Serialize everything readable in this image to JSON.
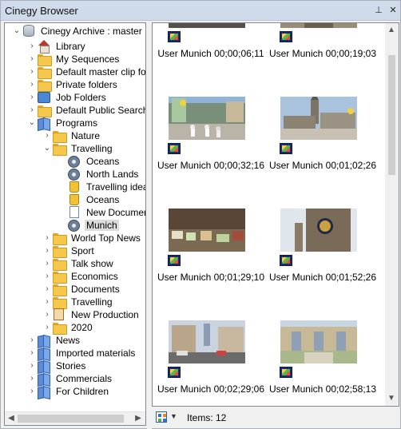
{
  "window": {
    "title": "Cinegy Browser",
    "pin_glyph": "⊥",
    "close_glyph": "✕"
  },
  "tree": {
    "items": [
      {
        "label": "Cinegy Archive : master",
        "icon": "database-icon",
        "expander": "collapse"
      },
      {
        "label": "Library",
        "icon": "library-icon",
        "expander": "expand"
      },
      {
        "label": "My Sequences",
        "icon": "folder-icon",
        "expander": "expand"
      },
      {
        "label": "Default master clip folder",
        "icon": "folder-icon",
        "expander": "expand"
      },
      {
        "label": "Private folders",
        "icon": "folder-icon",
        "expander": "expand"
      },
      {
        "label": "Job Folders",
        "icon": "job-folder-icon",
        "expander": "expand"
      },
      {
        "label": "Default Public Search Fo",
        "icon": "folder-icon",
        "expander": "expand"
      },
      {
        "label": "Programs",
        "icon": "book-icon",
        "expander": "collapse"
      },
      {
        "label": "Nature",
        "icon": "folder-icon",
        "expander": "expand"
      },
      {
        "label": "Travelling",
        "icon": "folder-icon",
        "expander": "collapse"
      },
      {
        "label": "Oceans",
        "icon": "reel-icon",
        "expander": "none"
      },
      {
        "label": "North Lands",
        "icon": "reel-icon",
        "expander": "none"
      },
      {
        "label": "Travelling ideas",
        "icon": "bin-icon",
        "expander": "none"
      },
      {
        "label": "Oceans",
        "icon": "bin-icon",
        "expander": "none"
      },
      {
        "label": "New Documen",
        "icon": "document-icon",
        "expander": "none"
      },
      {
        "label": "Munich",
        "icon": "reel-icon",
        "expander": "none",
        "selected": true
      },
      {
        "label": "World Top News",
        "icon": "folder-icon",
        "expander": "expand"
      },
      {
        "label": "Sport",
        "icon": "folder-icon",
        "expander": "expand"
      },
      {
        "label": "Talk show",
        "icon": "folder-icon",
        "expander": "expand"
      },
      {
        "label": "Economics",
        "icon": "folder-icon",
        "expander": "expand"
      },
      {
        "label": "Documents",
        "icon": "folder-icon",
        "expander": "expand"
      },
      {
        "label": "Travelling",
        "icon": "folder-icon",
        "expander": "expand"
      },
      {
        "label": "New Production",
        "icon": "production-icon",
        "expander": "expand"
      },
      {
        "label": "2020",
        "icon": "folder-icon",
        "expander": "expand"
      },
      {
        "label": "News",
        "icon": "book-icon",
        "expander": "expand"
      },
      {
        "label": "Imported materials",
        "icon": "book-icon",
        "expander": "expand"
      },
      {
        "label": "Stories",
        "icon": "book-icon",
        "expander": "expand"
      },
      {
        "label": "Commercials",
        "icon": "book-icon",
        "expander": "expand"
      },
      {
        "label": "For Children",
        "icon": "book-icon",
        "expander": "expand"
      }
    ]
  },
  "content": {
    "clips": [
      {
        "name": "User Munich 00;00;06;11",
        "scene": "partial-street"
      },
      {
        "name": "User Munich 00;00;19;03",
        "scene": "partial-building"
      },
      {
        "name": "User Munich 00;00;32;16",
        "scene": "square-crowd"
      },
      {
        "name": "User Munich 00;01;02;26",
        "scene": "church-plaza"
      },
      {
        "name": "User Munich 00;01;29;10",
        "scene": "market-stalls"
      },
      {
        "name": "User Munich 00;01;52;26",
        "scene": "town-hall-clock"
      },
      {
        "name": "User Munich 00;02;29;06",
        "scene": "street-traffic"
      },
      {
        "name": "User Munich 00;02;58;13",
        "scene": "arcade-garden"
      }
    ]
  },
  "status": {
    "items_label": "Items: 12",
    "view_dropdown_glyph": "▼"
  }
}
